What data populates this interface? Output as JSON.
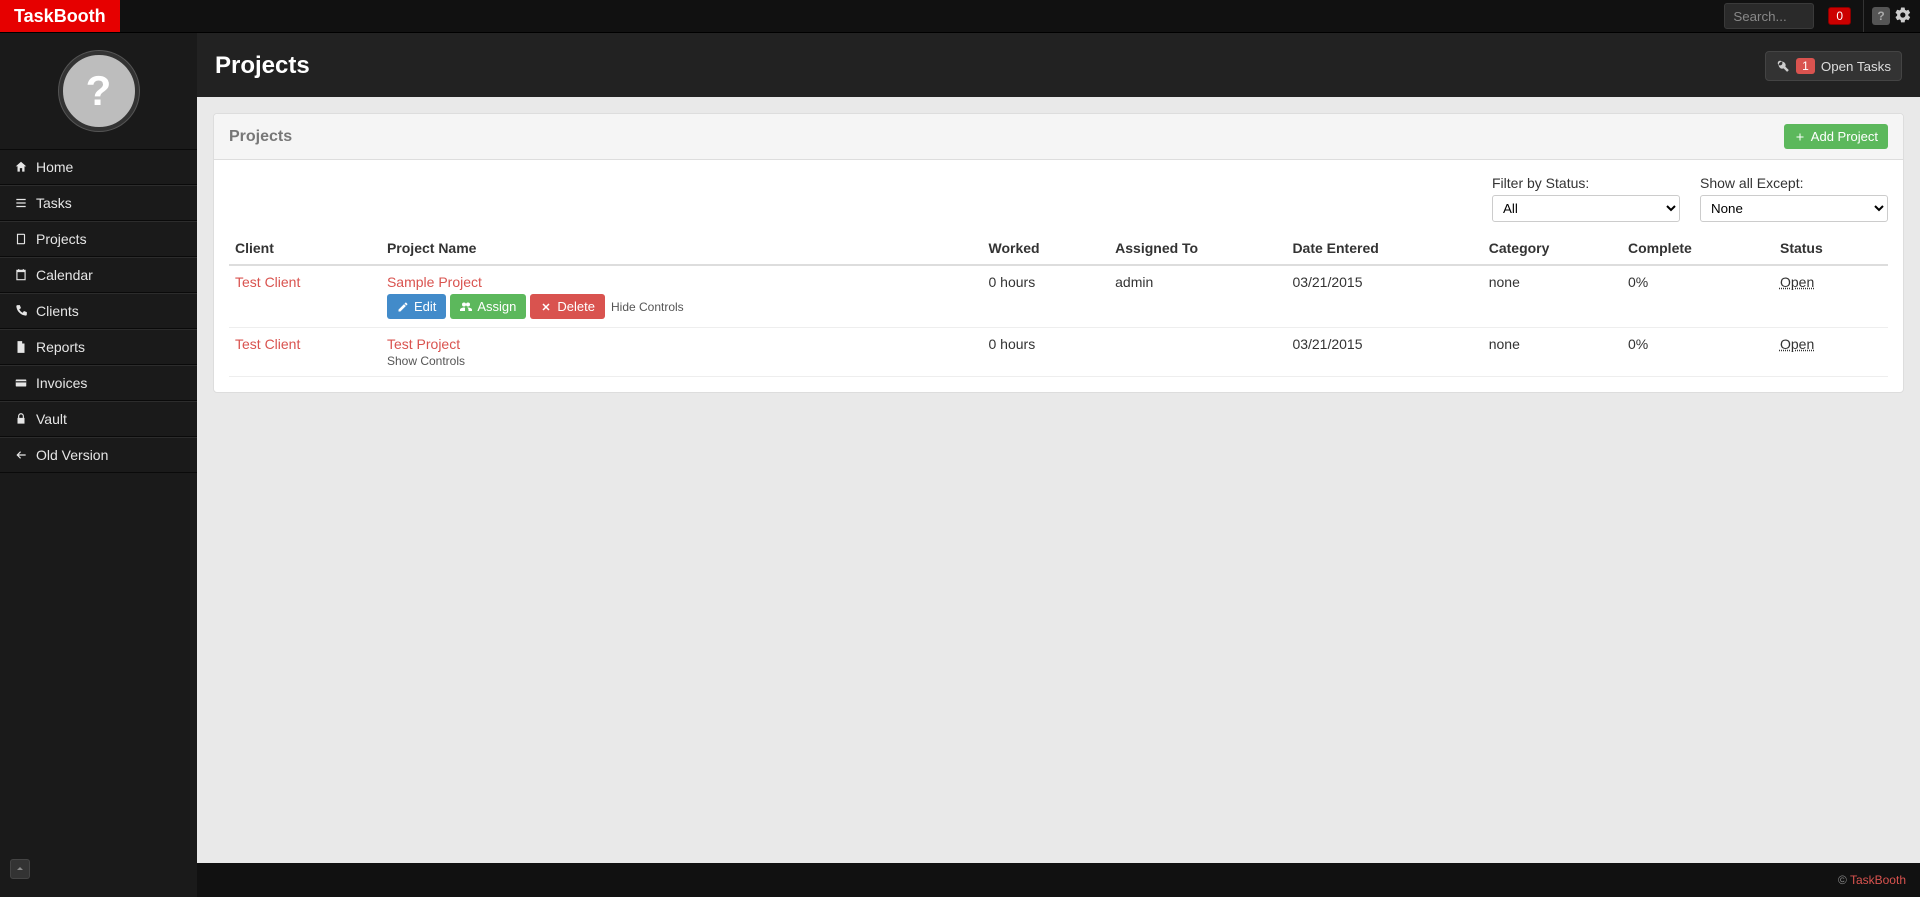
{
  "app": {
    "name": "TaskBooth"
  },
  "search": {
    "placeholder": "Search..."
  },
  "header": {
    "notification_count": "0",
    "open_tasks_count": "1",
    "open_tasks_label": "Open Tasks"
  },
  "sidebar": {
    "items": [
      {
        "label": "Home",
        "icon": "home-icon"
      },
      {
        "label": "Tasks",
        "icon": "list-icon"
      },
      {
        "label": "Projects",
        "icon": "book-icon"
      },
      {
        "label": "Calendar",
        "icon": "calendar-icon"
      },
      {
        "label": "Clients",
        "icon": "phone-icon"
      },
      {
        "label": "Reports",
        "icon": "file-icon"
      },
      {
        "label": "Invoices",
        "icon": "card-icon"
      },
      {
        "label": "Vault",
        "icon": "lock-icon"
      },
      {
        "label": "Old Version",
        "icon": "arrow-left-icon"
      }
    ]
  },
  "page": {
    "title": "Projects"
  },
  "panel": {
    "title": "Projects",
    "add_button": "Add Project",
    "filters": {
      "status_label": "Filter by Status:",
      "status_value": "All",
      "except_label": "Show all Except:",
      "except_value": "None"
    },
    "columns": {
      "client": "Client",
      "project": "Project Name",
      "worked": "Worked",
      "assigned": "Assigned To",
      "date": "Date Entered",
      "category": "Category",
      "complete": "Complete",
      "status": "Status"
    },
    "rows": [
      {
        "client": "Test Client",
        "project": "Sample Project",
        "worked": "0 hours",
        "assigned": "admin",
        "date": "03/21/2015",
        "category": "none",
        "complete": "0%",
        "status": "Open",
        "controls_expanded": true,
        "hide_label": "Hide Controls",
        "edit_label": "Edit",
        "assign_label": "Assign",
        "delete_label": "Delete"
      },
      {
        "client": "Test Client",
        "project": "Test Project",
        "worked": "0 hours",
        "assigned": "",
        "date": "03/21/2015",
        "category": "none",
        "complete": "0%",
        "status": "Open",
        "show_label": "Show Controls"
      }
    ]
  },
  "footer": {
    "copyright": "©",
    "brand": "TaskBooth"
  }
}
